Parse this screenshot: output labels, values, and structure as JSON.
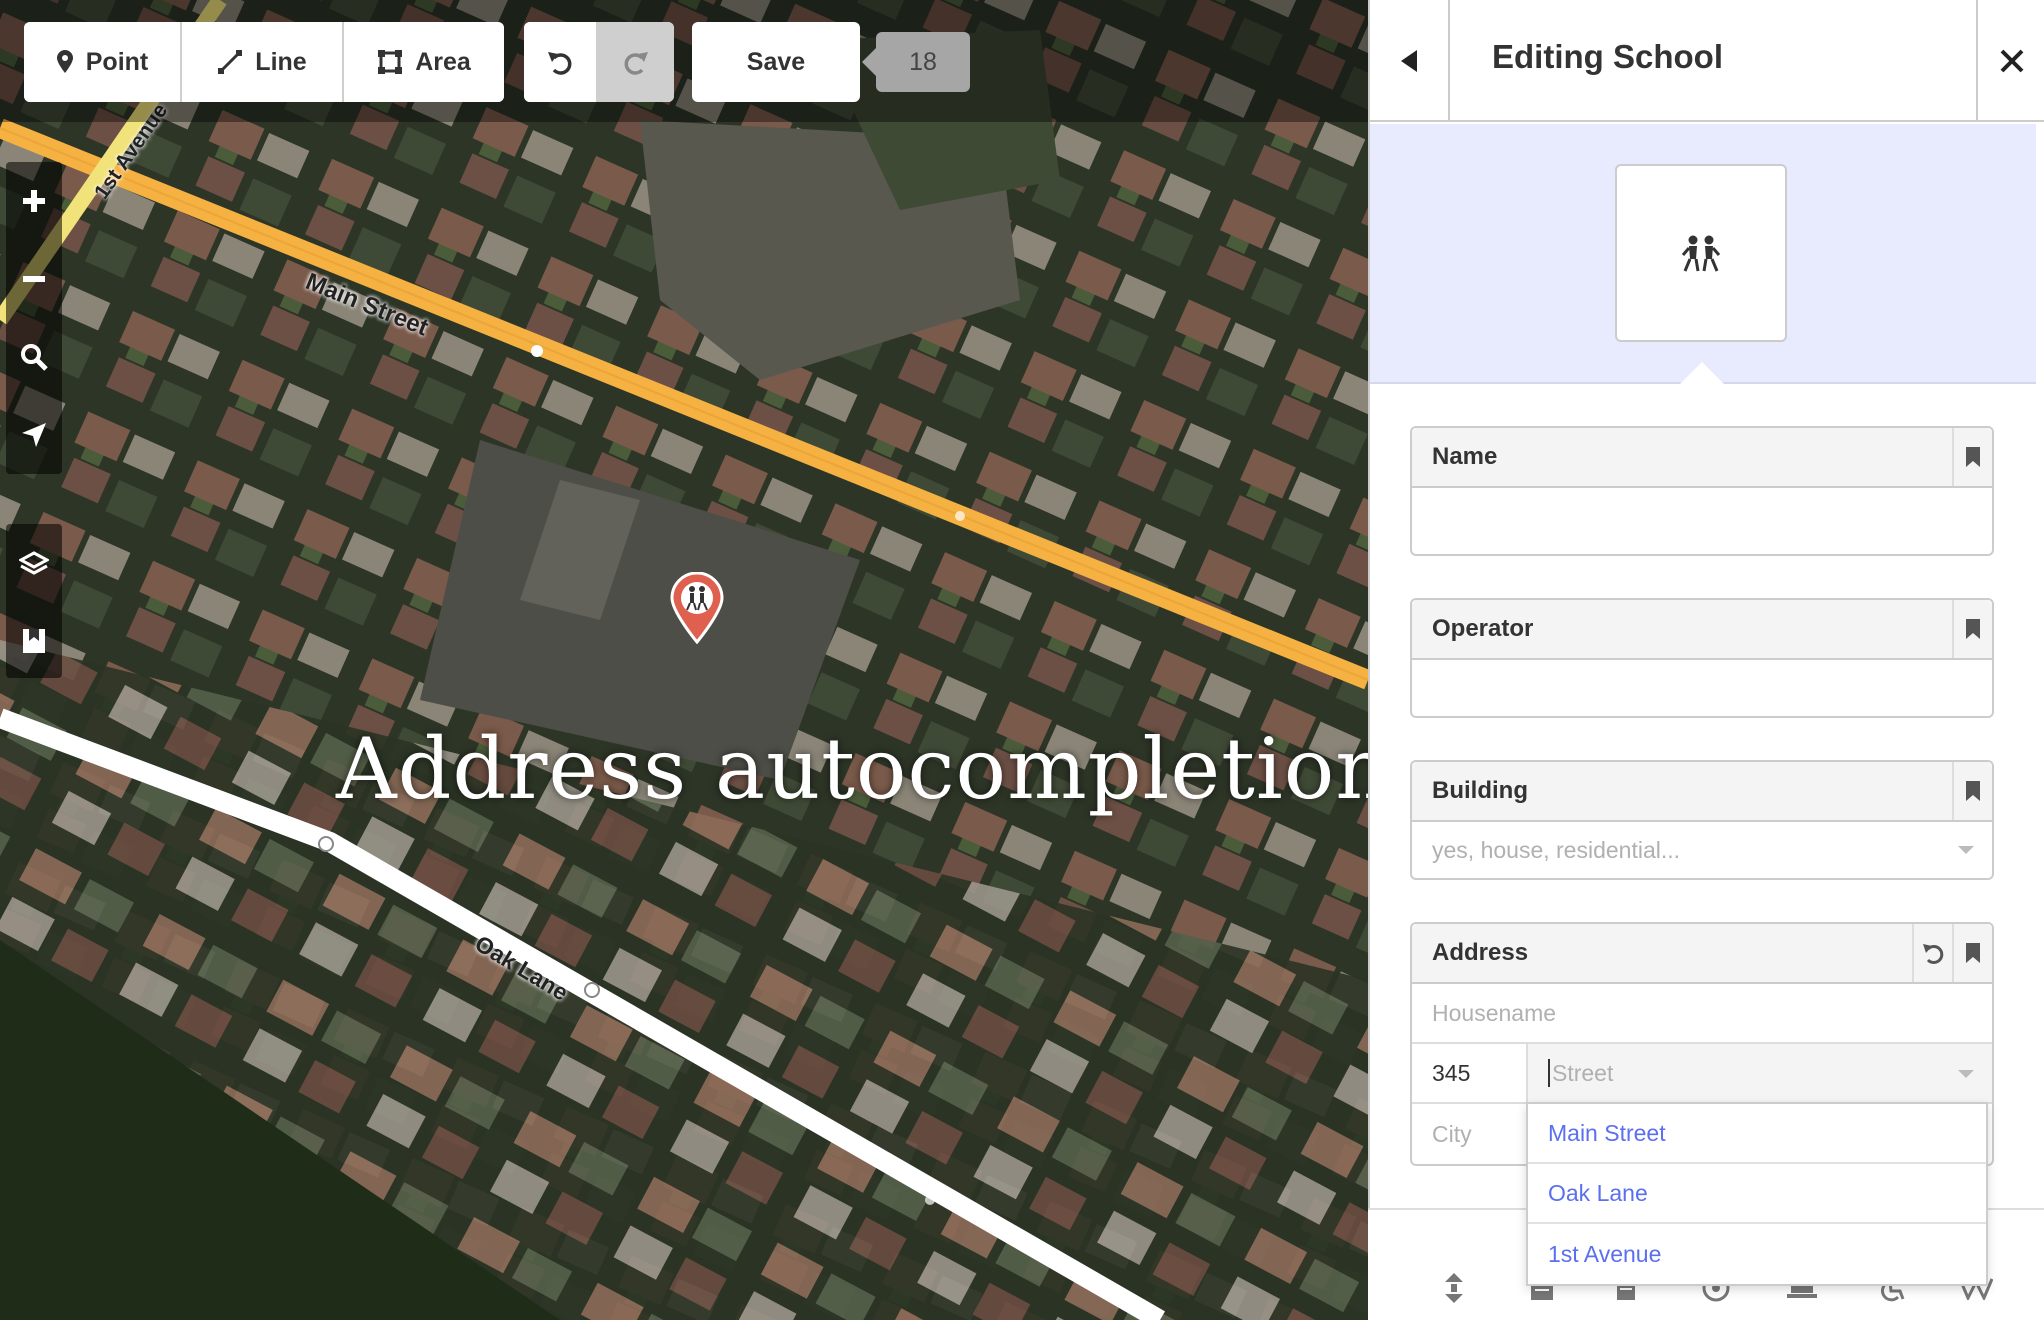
{
  "toolbar": {
    "point_label": "Point",
    "line_label": "Line",
    "area_label": "Area",
    "save_label": "Save",
    "edit_count": "18",
    "undo_icon": "undo-icon",
    "redo_icon": "redo-icon"
  },
  "map_controls": [
    "zoom-in-icon",
    "zoom-out-icon",
    "search-icon",
    "geolocate-icon",
    "layers-icon",
    "help-icon"
  ],
  "map_labels": {
    "main_street": "Main Street",
    "oak_lane": "Oak Lane",
    "first_avenue": "1st Avenue"
  },
  "caption": "Address autocompletion",
  "sidebar": {
    "title": "Editing School",
    "preset_icon": "school-icon",
    "fields": {
      "name": {
        "label": "Name",
        "value": ""
      },
      "operator": {
        "label": "Operator",
        "value": ""
      },
      "building": {
        "label": "Building",
        "placeholder": "yes, house, residential..."
      },
      "address": {
        "label": "Address",
        "housename_placeholder": "Housename",
        "housenumber": "345",
        "street_placeholder": "Street",
        "city_placeholder": "City"
      }
    },
    "autocomplete": [
      "Main Street",
      "Oak Lane",
      "1st Avenue"
    ],
    "footer_icons": [
      "elevation-icon",
      "note-icon",
      "document-icon",
      "circle-icon",
      "laptop-icon",
      "wheelchair-icon",
      "wikipedia-icon"
    ]
  },
  "colors": {
    "primary_road": "#f5b142",
    "residential_road": "#ffffff",
    "preset_bg": "#e8eafd",
    "link_blue": "#5b6ff0",
    "marker_red": "#e0604f"
  }
}
